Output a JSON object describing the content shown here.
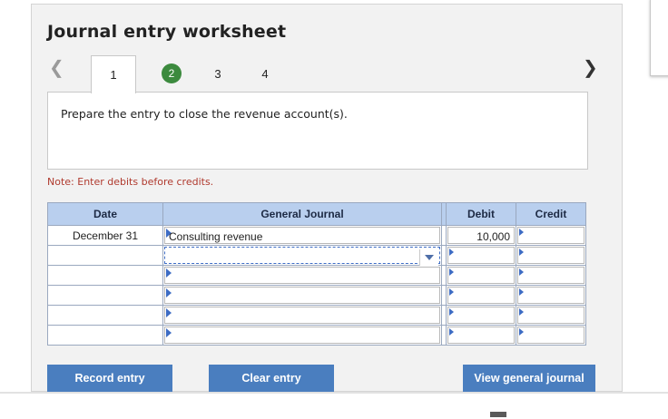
{
  "worksheet": {
    "title": "Journal entry worksheet",
    "tabs": [
      {
        "label": "1"
      },
      {
        "label": "2"
      },
      {
        "label": "3"
      },
      {
        "label": "4"
      }
    ],
    "prompt": "Prepare the entry to close the revenue account(s).",
    "note": "Note: Enter debits before credits."
  },
  "journal": {
    "headers": {
      "date": "Date",
      "general_journal": "General Journal",
      "debit": "Debit",
      "credit": "Credit"
    },
    "rows": [
      {
        "date": "December 31",
        "account": "Consulting revenue",
        "debit": "10,000",
        "credit": ""
      },
      {
        "date": "",
        "account": "",
        "debit": "",
        "credit": ""
      },
      {
        "date": "",
        "account": "",
        "debit": "",
        "credit": ""
      },
      {
        "date": "",
        "account": "",
        "debit": "",
        "credit": ""
      },
      {
        "date": "",
        "account": "",
        "debit": "",
        "credit": ""
      },
      {
        "date": "",
        "account": "",
        "debit": "",
        "credit": ""
      }
    ]
  },
  "buttons": {
    "record": "Record entry",
    "clear": "Clear entry",
    "view": "View general journal"
  },
  "colors": {
    "header_bg": "#b9cfee",
    "button_bg": "#4a7ebf",
    "active_step": "#3c8a3e",
    "note_text": "#b03a2e"
  }
}
